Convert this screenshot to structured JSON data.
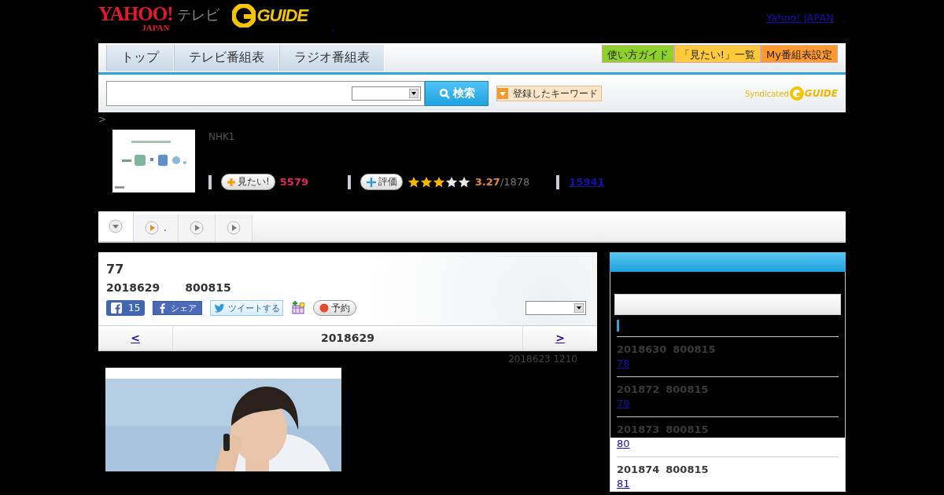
{
  "header": {
    "logo": "YAHOO!",
    "logo_sub": "JAPAN",
    "logo_tv": "テレビ",
    "gguide": "GUIDE",
    "mark": ",",
    "yahoo_link": "Yahoo! JAPAN",
    "link_mark": ","
  },
  "nav": {
    "tabs": [
      {
        "label": "トップ"
      },
      {
        "label": "テレビ番組表"
      },
      {
        "label": "ラジオ番組表"
      }
    ],
    "buttons": [
      {
        "label": "使い方ガイド",
        "color": "#8fd12a"
      },
      {
        "label": "「見たい!」一覧",
        "color": "#ffc93c"
      },
      {
        "label": "My番組表設定",
        "color": "#ff9a2e"
      }
    ]
  },
  "search": {
    "button": "検索",
    "keyword_button": "登録したキーワード",
    "syndicated": "Syndicated",
    "gguide": "GUIDE"
  },
  "breadcrumb": ">",
  "program": {
    "channel": "NHK1",
    "want_button": "見たい!",
    "want_count": "5579",
    "rate_button": "評価",
    "stars": 3,
    "score": "3.27",
    "votes": "/1878",
    "link": "15941"
  },
  "program_tabs": [
    {
      "kind": "menu",
      "selected": true
    },
    {
      "kind": "play",
      "selected": false,
      "active": true,
      "label": "."
    },
    {
      "kind": "play",
      "selected": false,
      "active": false
    },
    {
      "kind": "play",
      "selected": false,
      "active": false
    }
  ],
  "detail": {
    "title": "77",
    "date": "2018629",
    "time": "800815",
    "like_count": "15",
    "share": "シェア",
    "tweet": "ツイートする",
    "reserve": "予約",
    "pager": {
      "prev": "<",
      "current": "2018629",
      "next": ">"
    },
    "updated": "2018623  1210"
  },
  "sidebar": {
    "items": [
      {
        "date": "2018630",
        "time": "800815",
        "link": "78"
      },
      {
        "date": "201872",
        "time": "800815",
        "link": "79"
      },
      {
        "date": "201873",
        "time": "800815",
        "link": "80"
      },
      {
        "date": "201874",
        "time": "800815",
        "link": "81"
      }
    ]
  }
}
